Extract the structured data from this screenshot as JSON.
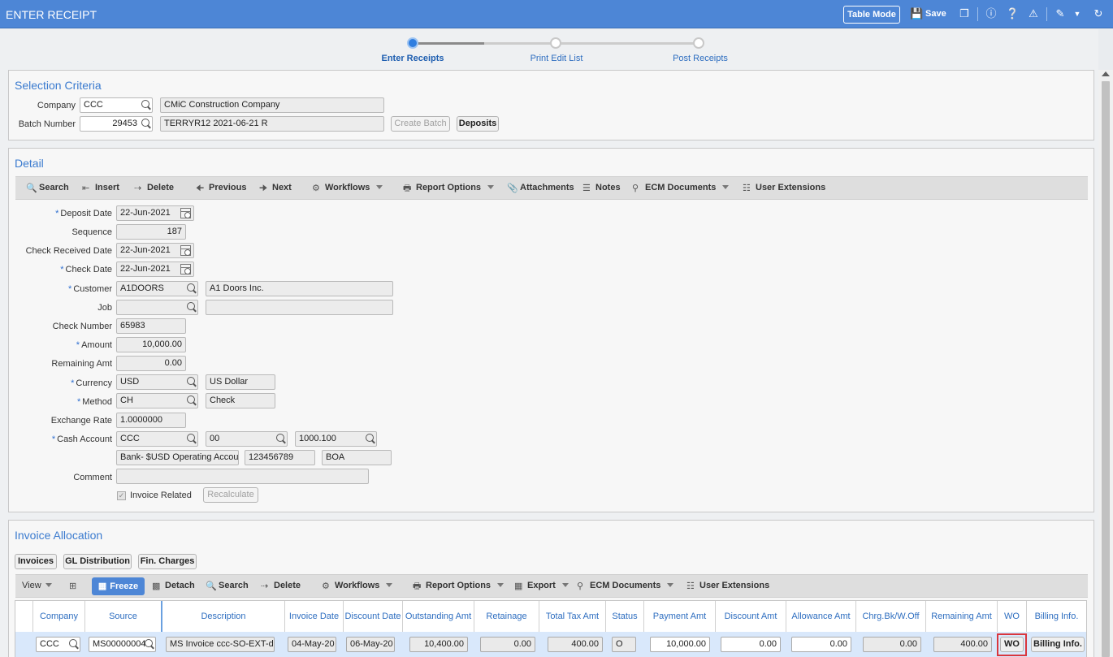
{
  "header": {
    "title": "ENTER RECEIPT",
    "table_mode": "Table Mode",
    "save": "Save"
  },
  "steps": [
    "Enter Receipts",
    "Print Edit List",
    "Post Receipts"
  ],
  "selection": {
    "title": "Selection Criteria",
    "company_label": "Company",
    "company_code": "CCC",
    "company_name": "CMiC Construction Company",
    "batch_label": "Batch Number",
    "batch_number": "29453",
    "batch_desc": "TERRYR12 2021-06-21 R",
    "create_batch": "Create Batch",
    "deposits": "Deposits"
  },
  "detail": {
    "title": "Detail",
    "toolbar": [
      "Search",
      "Insert",
      "Delete",
      "Previous",
      "Next",
      "Workflows",
      "Report Options",
      "Attachments",
      "Notes",
      "ECM Documents",
      "User Extensions"
    ],
    "labels": {
      "deposit_date": "Deposit Date",
      "sequence": "Sequence",
      "check_received": "Check Received Date",
      "check_date": "Check Date",
      "customer": "Customer",
      "job": "Job",
      "check_number": "Check Number",
      "amount": "Amount",
      "remaining": "Remaining Amt",
      "currency": "Currency",
      "method": "Method",
      "exchange": "Exchange Rate",
      "cash_account": "Cash Account",
      "comment": "Comment",
      "invoice_related": "Invoice Related",
      "recalculate": "Recalculate"
    },
    "values": {
      "deposit_date": "22-Jun-2021",
      "sequence": "187",
      "check_received": "22-Jun-2021",
      "check_date": "22-Jun-2021",
      "customer_code": "A1DOORS",
      "customer_name": "A1 Doors Inc.",
      "check_number": "65983",
      "amount": "10,000.00",
      "remaining": "0.00",
      "currency_code": "USD",
      "currency_name": "US Dollar",
      "method_code": "CH",
      "method_name": "Check",
      "exchange": "1.0000000",
      "cash_company": "CCC",
      "cash_dept": "00",
      "cash_gl": "1000.100",
      "bank_name": "Bank- $USD Operating Accour",
      "bank_account": "123456789",
      "bank_code": "BOA"
    }
  },
  "allocation": {
    "title": "Invoice Allocation",
    "buttons": [
      "Invoices",
      "GL Distribution",
      "Fin. Charges"
    ],
    "toolbar": {
      "view": "View",
      "freeze": "Freeze",
      "detach": "Detach",
      "search": "Search",
      "delete": "Delete",
      "workflows": "Workflows",
      "report": "Report Options",
      "export": "Export",
      "ecm": "ECM Documents",
      "ext": "User Extensions"
    },
    "columns": [
      "Company",
      "Source",
      "Description",
      "Invoice Date",
      "Discount Date",
      "Outstanding Amt",
      "Retainage",
      "Total Tax Amt",
      "Status",
      "Payment Amt",
      "Discount Amt",
      "Allowance Amt",
      "Chrg.Bk/W.Off",
      "Remaining Amt",
      "WO",
      "Billing Info."
    ],
    "row": {
      "company": "CCC",
      "source": "MS00000004",
      "description": "MS Invoice ccc-SO-EXT-dl",
      "invoice_date": "04-May-20",
      "discount_date": "06-May-20",
      "outstanding": "10,400.00",
      "retainage": "0.00",
      "tax": "400.00",
      "status": "O",
      "payment": "10,000.00",
      "discount": "0.00",
      "allowance": "0.00",
      "chargeback": "0.00",
      "remaining": "400.00",
      "wo": "WO",
      "billing": "Billing Info."
    }
  }
}
